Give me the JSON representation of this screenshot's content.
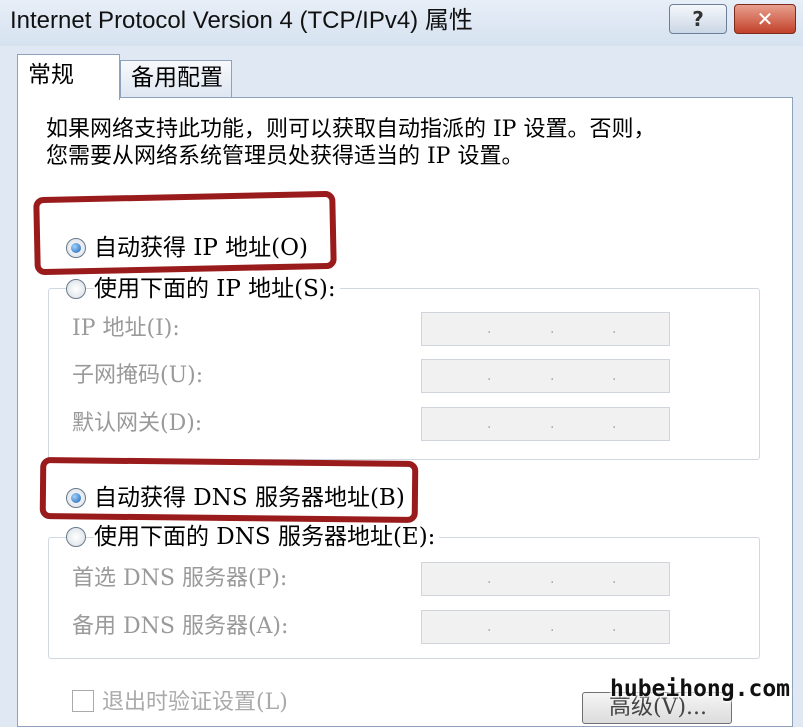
{
  "window": {
    "title": "Internet Protocol Version 4 (TCP/IPv4) 属性",
    "help_label": "?",
    "close_label": "✕"
  },
  "tabs": [
    {
      "label": "常规",
      "selected": true
    },
    {
      "label": "备用配置",
      "selected": false
    }
  ],
  "description": [
    "如果网络支持此功能，则可以获取自动指派的 IP 设置。否则，",
    "您需要从网络系统管理员处获得适当的 IP 设置。"
  ],
  "ip_options": {
    "auto_label": "自动获得 IP 地址(O)",
    "auto_selected": true,
    "manual_label": "使用下面的 IP 地址(S):",
    "fields": [
      {
        "label": "IP 地址(I):",
        "value": ". . ."
      },
      {
        "label": "子网掩码(U):",
        "value": ". . ."
      },
      {
        "label": "默认网关(D):",
        "value": ". . ."
      }
    ]
  },
  "dns_options": {
    "auto_label": "自动获得 DNS 服务器地址(B)",
    "auto_selected": true,
    "manual_label": "使用下面的 DNS 服务器地址(E):",
    "fields": [
      {
        "label": "首选 DNS 服务器(P):",
        "value": ". . ."
      },
      {
        "label": "备用 DNS 服务器(A):",
        "value": ". . ."
      }
    ]
  },
  "footer": {
    "validate_label": "退出时验证设置(L)",
    "advanced_label": "高级(V)..."
  },
  "watermark": "hubeihong.com",
  "colors": {
    "annotation_red": "#9a1b1b",
    "close_button": "#c2412a",
    "disabled_text": "#9a9a9a"
  }
}
